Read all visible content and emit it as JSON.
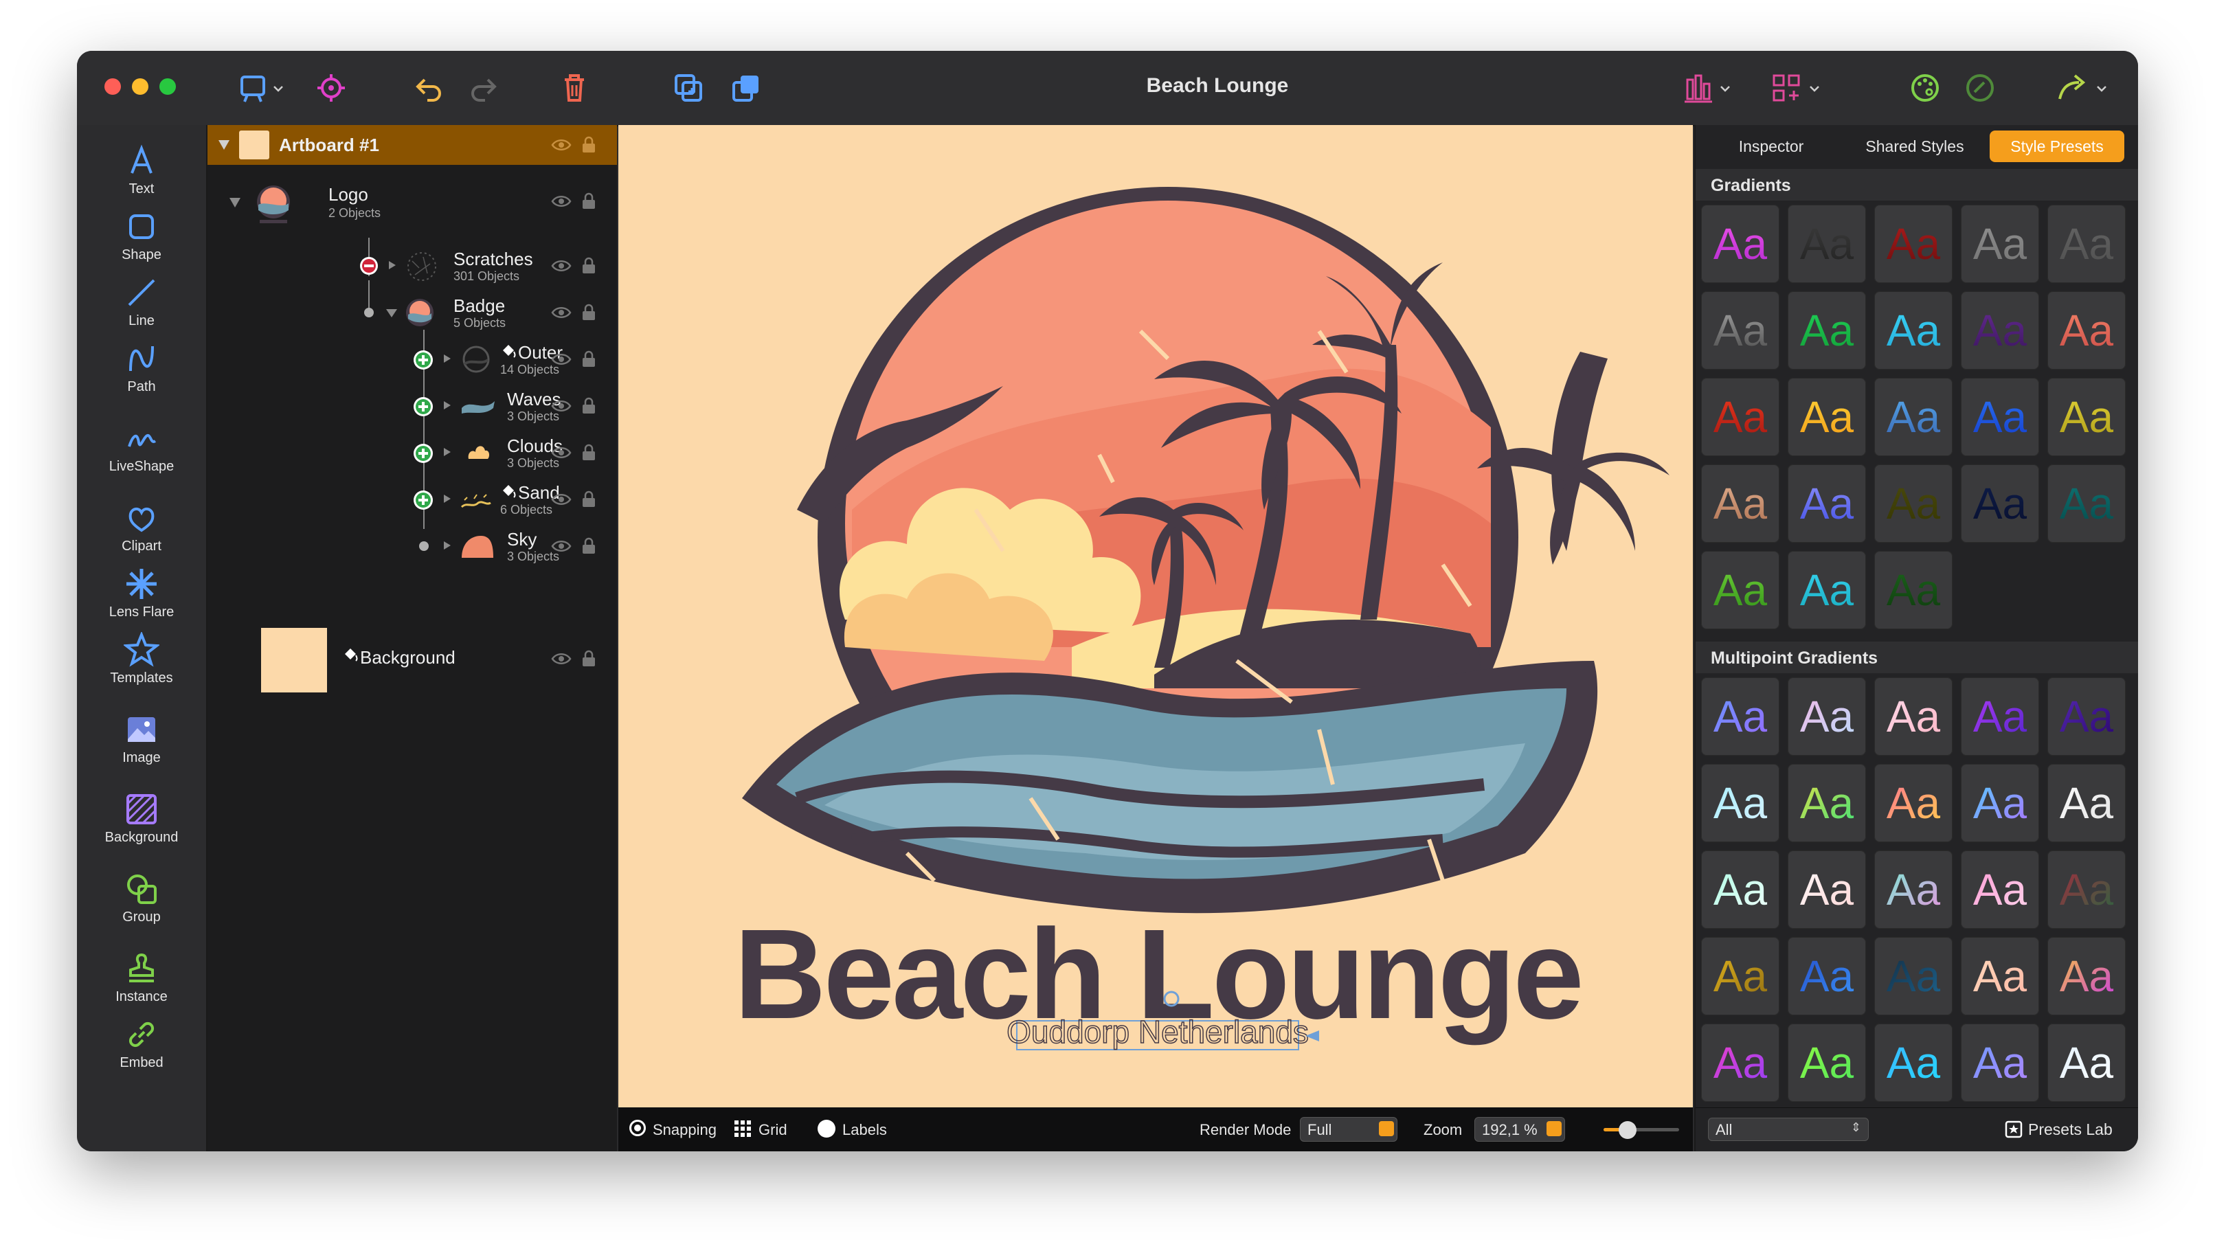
{
  "window": {
    "title": "Beach Lounge",
    "light_colors": [
      "#fe5f57",
      "#febc2e",
      "#28c840"
    ]
  },
  "toolbar": {
    "icons": [
      "artboard-icon",
      "target-icon",
      "undo-icon",
      "redo-icon",
      "trash-icon",
      "group-add-icon",
      "arrange-icon",
      "align-icon",
      "distribute-icon",
      "palette-icon",
      "style-icon",
      "share-icon"
    ]
  },
  "tools": [
    {
      "label": "Text",
      "icon": "text-tool-icon"
    },
    {
      "label": "Shape",
      "icon": "shape-tool-icon"
    },
    {
      "label": "Line",
      "icon": "line-tool-icon"
    },
    {
      "label": "Path",
      "icon": "path-tool-icon"
    },
    {
      "label": "LiveShape",
      "icon": "liveshape-tool-icon"
    },
    {
      "label": "Clipart",
      "icon": "clipart-tool-icon"
    },
    {
      "label": "Lens Flare",
      "icon": "lens-flare-tool-icon"
    },
    {
      "label": "Templates",
      "icon": "templates-tool-icon"
    },
    {
      "label": "Image",
      "icon": "image-tool-icon"
    },
    {
      "label": "Background",
      "icon": "background-tool-icon"
    },
    {
      "label": "Group",
      "icon": "group-tool-icon"
    },
    {
      "label": "Instance",
      "icon": "instance-tool-icon"
    },
    {
      "label": "Embed",
      "icon": "embed-tool-icon"
    }
  ],
  "layers": {
    "artboard": "Artboard #1",
    "items": [
      {
        "title": "Logo",
        "subtitle": "2 Objects"
      },
      {
        "title": "Scratches",
        "subtitle": "301 Objects"
      },
      {
        "title": "Badge",
        "subtitle": "5 Objects"
      },
      {
        "title": "Outer",
        "subtitle": "14 Objects"
      },
      {
        "title": "Waves",
        "subtitle": "3 Objects"
      },
      {
        "title": "Clouds",
        "subtitle": "3 Objects"
      },
      {
        "title": "Sand",
        "subtitle": "6 Objects"
      },
      {
        "title": "Sky",
        "subtitle": "3 Objects"
      },
      {
        "title": "Background",
        "subtitle": ""
      }
    ]
  },
  "canvas": {
    "headline": "Beach Lounge",
    "subline": "Ouddorp Netherlands",
    "colors": {
      "bg": "#fcd9aa",
      "dark": "#453a46",
      "sun": "#f6957a",
      "cloud": "#fde29a",
      "wave": "#6f9aac"
    }
  },
  "bottom": {
    "snapping": "Snapping",
    "grid": "Grid",
    "labels": "Labels",
    "render_mode_label": "Render Mode",
    "render_mode_value": "Full",
    "zoom_label": "Zoom",
    "zoom_value": "192,1 %"
  },
  "right": {
    "tabs": [
      "Inspector",
      "Shared Styles",
      "Style Presets"
    ],
    "gradients_header": "Gradients",
    "multipoint_header": "Multipoint Gradients",
    "sample": "Aa",
    "filter_value": "All",
    "presets_lab": "Presets Lab",
    "accent": "#f59e1c"
  }
}
